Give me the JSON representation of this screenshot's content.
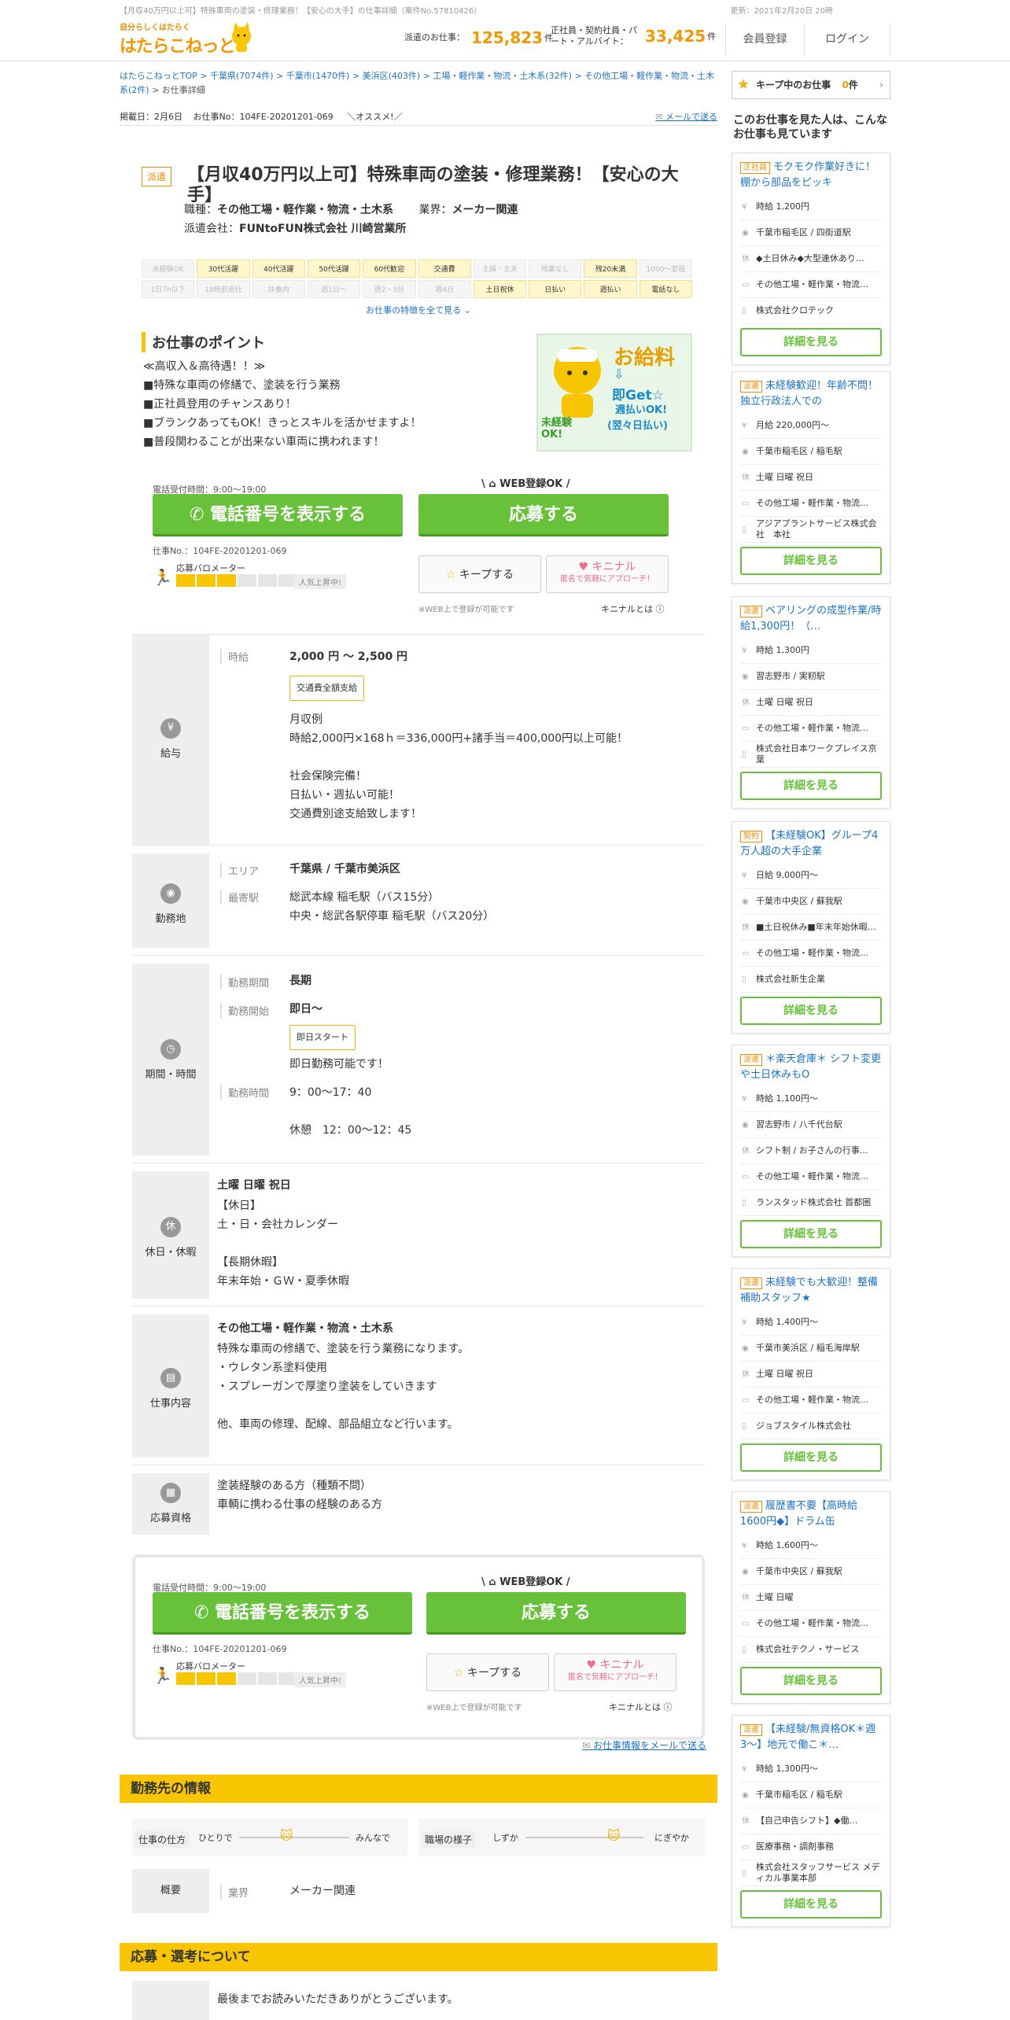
{
  "top_note": {
    "left": "【月収40万円以上可】特殊車両の塗装・修理業務！【安心の大手】の仕事詳細（案件No.57810426）",
    "right": "更新：2021年2月20日 20時"
  },
  "header": {
    "logo_tag": "自分らしくはたらく",
    "logo_name": "はたらこねっと",
    "haken_label": "派遣のお仕事：",
    "haken_count": "125,823",
    "haken_unit": "件",
    "seishain_label": "正社員・契約社員・パート・アルバイト：",
    "seishain_count": "33,425",
    "seishain_unit": "件",
    "register": "会員登録",
    "login": "ログイン"
  },
  "breadcrumb": {
    "path": "はたらこねっとTOP > 千葉県(7074件) > 千葉市(1470件) > 美浜区(403件) > 工場・軽作業・物流・土木系(32件) > その他工場・軽作業・物流・土木系(2件)",
    "current": "> お仕事詳細"
  },
  "post": {
    "date": "掲載日：2月6日",
    "no": "お仕事No：104FE-20201201-069",
    "osusume": "＼オススメ!／",
    "mail": "メールで送る"
  },
  "job": {
    "type_badge": "派遣",
    "title": "【月収40万円以上可】特殊車両の塗装・修理業務！【安心の大手】",
    "category_label": "職種：",
    "category": "その他工場・軽作業・物流・土木系",
    "industry_label": "業界：",
    "industry": "メーカー関連",
    "company_label": "派遣会社：",
    "company": "FUNtoFUN株式会社 川崎営業所"
  },
  "tags": [
    {
      "t": "未経験OK",
      "on": false
    },
    {
      "t": "30代活躍",
      "on": true
    },
    {
      "t": "40代活躍",
      "on": true
    },
    {
      "t": "50代活躍",
      "on": true
    },
    {
      "t": "60代歓迎",
      "on": true
    },
    {
      "t": "交通費",
      "on": true
    },
    {
      "t": "主婦・主夫",
      "on": false
    },
    {
      "t": "残業なし",
      "on": false
    },
    {
      "t": "残20未満",
      "on": true
    },
    {
      "t": "1000～室程",
      "on": false
    },
    {
      "t": "1日7h以下",
      "on": false
    },
    {
      "t": "18時前退社",
      "on": false
    },
    {
      "t": "扶養内",
      "on": false
    },
    {
      "t": "週1日～",
      "on": false
    },
    {
      "t": "週2・3日",
      "on": false
    },
    {
      "t": "週4日",
      "on": false
    },
    {
      "t": "土日祝休",
      "on": true
    },
    {
      "t": "日払い",
      "on": true
    },
    {
      "t": "週払い",
      "on": true
    },
    {
      "t": "電話なし",
      "on": true
    }
  ],
  "tags_more": "お仕事の特徴を全て見る ⌄",
  "points": {
    "title": "お仕事のポイント",
    "body": "≪高収入＆高待遇！！≫\n■特殊な車両の修繕で、塗装を行う業務\n■正社員登用のチャンスあり！\n■ブランクあってもOK！きっとスキルを活かせますよ！\n■普段関わることが出来ない車両に携われます！"
  },
  "promo": {
    "l1": "お給料",
    "l2": "即Get☆",
    "l3": "週払いOK!",
    "l4": "(翌々日払い)",
    "l5": "未経験OK!"
  },
  "apply": {
    "tel_note": "電話受付時間：9:00～19:00",
    "web_label": "WEB登録OK",
    "tel_btn": "電話番号を表示する",
    "app_btn": "応募する",
    "jobno": "仕事No.：104FE-20201201-069",
    "meter": "応募バロメーター",
    "pop": "人気上昇中!",
    "keep": "キープする",
    "kini": "キニナル",
    "kini_sub": "匿名で気軽にアプローチ！",
    "web_note": "※WEB上で登録が可能です",
    "kini_note": "キニナルとは",
    "meter_fill": 3,
    "meter_total": 6
  },
  "salary": {
    "head": "給与",
    "key": "時給",
    "value": "2,000 円 ～ 2,500 円",
    "badge": "交通費全額支給",
    "detail": "月収例\n時給2,000円×168ｈ＝336,000円+諸手当＝400,000円以上可能！\n\n社会保険完備！\n日払い・週払い可能！\n交通費別途支給致します！"
  },
  "location": {
    "head": "勤務地",
    "area_key": "エリア",
    "area": "千葉県 / 千葉市美浜区",
    "station_key": "最寄駅",
    "station": "総武本線 稲毛駅（バス15分）\n中央・総武各駅停車 稲毛駅（バス20分）"
  },
  "period": {
    "head": "期間・時間",
    "term_key": "勤務期間",
    "term": "長期",
    "start_key": "勤務開始",
    "start": "即日～",
    "start_badge": "即日スタート",
    "start_note": "即日勤務可能です！",
    "time_key": "勤務時間",
    "time": "9：00～17：40\n\n休憩　12：00～12：45"
  },
  "holiday": {
    "head": "休日・休暇",
    "title": "土曜 日曜 祝日",
    "body": "【休日】\n土・日・会社カレンダー\n\n【長期休暇】\n年末年始・ＧＷ・夏季休暇"
  },
  "work": {
    "head": "仕事内容",
    "title": "その他工場・軽作業・物流・土木系",
    "body": "特殊な車両の修繕で、塗装を行う業務になります。\n・ウレタン系塗料使用\n・スプレーガンで厚塗り塗装をしていきます\n\n他、車両の修理、配線、部品組立など行います。"
  },
  "qual": {
    "head": "応募資格",
    "body": "塗装経験のある方（種類不問）\n車輌に携わる仕事の経験のある方"
  },
  "mail2": "お仕事情報をメールで送る",
  "workplace": {
    "bar": "勤務先の情報",
    "style_key": "仕事の仕方",
    "style_l": "ひとりで",
    "style_r": "みんなで",
    "mood_key": "職場の様子",
    "mood_l": "しずか",
    "mood_r": "にぎやか",
    "overview_key": "概要",
    "industry_key": "業界",
    "industry": "メーカー関連"
  },
  "selection": {
    "bar": "応募・選考について",
    "body": "最後までお読みいただきありがとうございます。"
  },
  "sidebar": {
    "keep_label": "キープ中のお仕事",
    "keep_count": "0",
    "keep_unit": "件",
    "heading": "このお仕事を見た人は、こんなお仕事も見ています",
    "detail": "詳細を見る",
    "cards": [
      {
        "kind": "正社員",
        "title": "モクモク作業好きに！棚から部品をピッキ",
        "rows": [
          "時給 1,200円",
          "千葉市稲毛区 / 四街道駅",
          "◆土日休み◆大型連休あり…",
          "その他工場・軽作業・物流…",
          "株式会社クロテック"
        ]
      },
      {
        "kind": "派遣",
        "title": "未経験歓迎！年齢不問！独立行政法人での",
        "rows": [
          "月給 220,000円～",
          "千葉市稲毛区 / 稲毛駅",
          "土曜 日曜 祝日",
          "その他工場・軽作業・物流…",
          "アジアプラントサービス株式会社　本社"
        ]
      },
      {
        "kind": "派遣",
        "title": "ベアリングの成型作業/時給1,300円！（…",
        "rows": [
          "時給 1,300円",
          "習志野市 / 実籾駅",
          "土曜 日曜 祝日",
          "その他工場・軽作業・物流…",
          "株式会社日本ワークプレイス京葉"
        ]
      },
      {
        "kind": "契約",
        "title": "【未経験OK】グループ4万人超の大手企業",
        "rows": [
          "日給 9,000円～",
          "千葉市中央区 / 蘇我駅",
          "■土日祝休み■年末年始休暇…",
          "その他工場・軽作業・物流…",
          "株式会社新生企業"
        ]
      },
      {
        "kind": "派遣",
        "title": "＊楽天倉庫＊ シフト変更や土日休みもO",
        "rows": [
          "時給 1,100円～",
          "習志野市 / 八千代台駅",
          "シフト制 / お子さんの行事…",
          "その他工場・軽作業・物流…",
          "ランスタッド株式会社 首都圏"
        ]
      },
      {
        "kind": "派遣",
        "title": "未経験でも大歓迎！整備補助スタッフ★",
        "rows": [
          "時給 1,400円～",
          "千葉市美浜区 / 稲毛海岸駅",
          "土曜 日曜 祝日",
          "その他工場・軽作業・物流…",
          "ジョブスタイル株式会社"
        ]
      },
      {
        "kind": "派遣",
        "title": "履歴書不要【高時給1600円◆】ドラム缶",
        "rows": [
          "時給 1,600円～",
          "千葉市中央区 / 蘇我駅",
          "土曜 日曜",
          "その他工場・軽作業・物流…",
          "株式会社テクノ・サービス"
        ]
      },
      {
        "kind": "派遣",
        "title": "【未経験/無資格OK＊週3～】地元で働こ＊…",
        "rows": [
          "時給 1,300円～",
          "千葉市稲毛区 / 稲毛駅",
          "【自己申告シフト】◆働…",
          "医療事務・調剤事務",
          "株式会社スタッフサービス メディカル事業本部"
        ]
      }
    ]
  }
}
